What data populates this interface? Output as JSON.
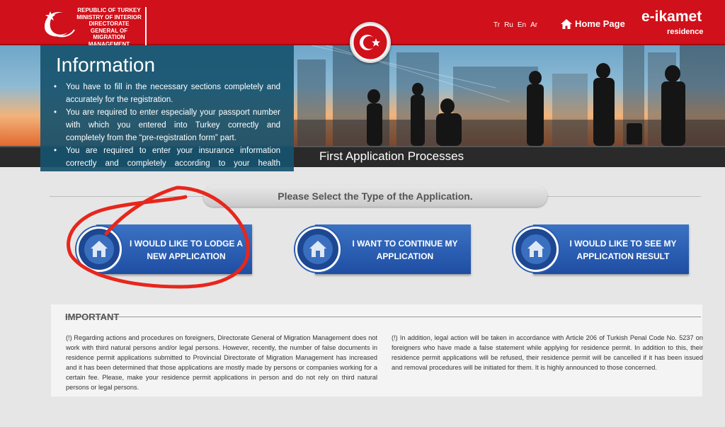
{
  "header": {
    "brand_lines": [
      "REPUBLIC OF TURKEY",
      "MINISTRY OF INTERIOR",
      "DIRECTORATE GENERAL OF",
      "MIGRATION MANAGEMENT"
    ],
    "languages": [
      "Tr",
      "Ru",
      "En",
      "Ar"
    ],
    "home_label": "Home Page",
    "eikamet_main": "e-ikamet",
    "eikamet_sub": "residence"
  },
  "banner": {
    "title": "First Application Processes"
  },
  "info": {
    "title": "Information",
    "items": [
      "You have to fill in the necessary sections completely and accurately for the registration.",
      "You are required to enter especially your passport number with which you entered into Turkey correctly and completely from the “pre-registration form” part.",
      "You are required to enter your insurance information correctly and completely according to your health insurance."
    ]
  },
  "select": {
    "title": "Please Select the Type of the Application."
  },
  "buttons": [
    {
      "label_line1": "I WOULD LIKE TO LODGE A",
      "label_line2": "NEW APPLICATION"
    },
    {
      "label_line1": "I WANT TO CONTINUE MY",
      "label_line2": "APPLICATION"
    },
    {
      "label_line1": "I WOULD LIKE TO SEE MY",
      "label_line2": "APPLICATION RESULT"
    }
  ],
  "important": {
    "title": "IMPORTANT",
    "left": "(!) Regarding actions and procedures on foreigners, Directorate General of Migration Management does not work with third natural persons and/or legal persons. However, recently, the number of false documents in residence permit applications submitted to Provincial Directorate of Migration Management has increased and it has been determined that those applications are mostly made by persons or companies working for a certain fee. Please, make your residence permit applications in person and do not rely on third natural persons or legal persons.",
    "right": "(!) In addition, legal action will be taken in accordance with Article 206 of Turkish Penal Code No. 5237 on foreigners who have made a false statement while applying for residence permit. In addition to this, their residence permit applications will be refused, their residence permit will be cancelled if it has been issued and removal procedures will be initiated for them. It is highly announced to those concerned."
  },
  "colors": {
    "header_red": "#d0101a",
    "info_teal": "#17526e",
    "button_blue": "#2a5cb0",
    "annotation_red": "#e8261c"
  }
}
